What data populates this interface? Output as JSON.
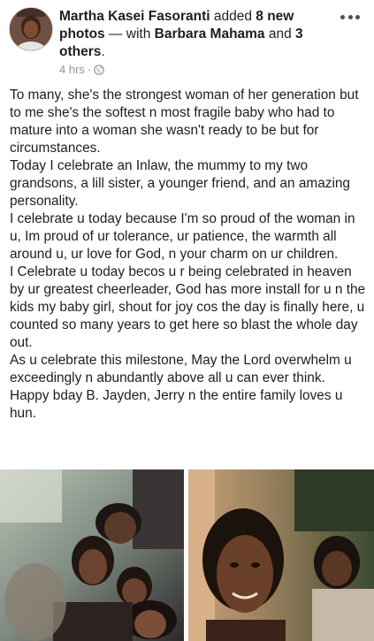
{
  "post": {
    "author": "Martha Kasei Fasoranti",
    "added_text": " added ",
    "photo_count": "8 new photos",
    "with_text": " — with ",
    "tagged_person": "Barbara Mahama",
    "and_text": " and ",
    "others": "3 others",
    "period": ".",
    "timestamp": "4 hrs",
    "separator": "·",
    "privacy_icon": "globe-icon",
    "more_icon": "more-options-icon",
    "paragraphs": [
      "To many, she's the strongest woman of her generation but to me she's the softest n most fragile baby who had to mature into a woman she wasn't ready to be but for circumstances.",
      "Today I celebrate an Inlaw, the mummy to my two grandsons, a lill sister, a younger friend, and an amazing personality.",
      "I celebrate u today because I'm so proud of the woman in u, Im proud of ur tolerance, ur patience, the warmth all around u, ur love for God, n your charm on ur children.",
      "I Celebrate u today becos u r being celebrated in heaven by ur greatest cheerleader, God has more install for u n the kids my baby girl, shout for joy cos the day is finally here, u counted so many years to get here so blast the whole day out.",
      "As u celebrate this milestone, May the Lord overwhelm u exceedingly n abundantly above all u can ever think.",
      "Happy bday B. Jayden, Jerry n the entire family loves u hun."
    ]
  }
}
